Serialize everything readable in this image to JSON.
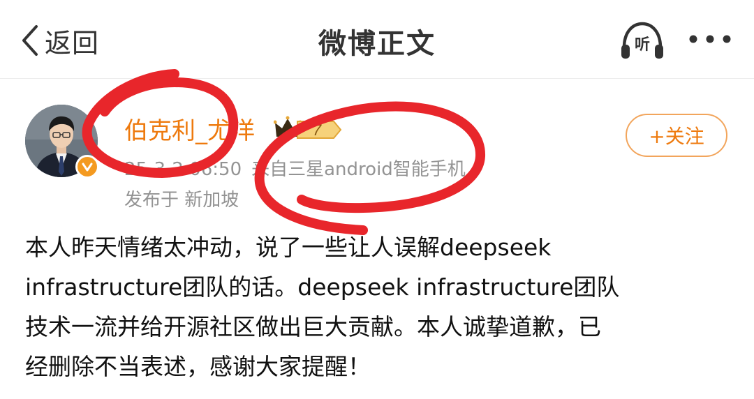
{
  "nav": {
    "back_label": "返回",
    "title": "微博正文",
    "listen_label": "听",
    "icons": {
      "back": "chevron-left-icon",
      "listen": "headphones-icon",
      "more": "more-dots-icon"
    }
  },
  "post": {
    "author": {
      "name": "伯克利_尤洋",
      "verified": true,
      "vip_level": "7"
    },
    "meta": {
      "time": "25-3-2 06:50",
      "source": "来自三星android智能手机",
      "location": "发布于 新加坡"
    },
    "follow_label": "+关注",
    "text_lines": [
      "本人昨天情绪太冲动，说了一些让人误解deepseek",
      "infrastructure团队的话。deepseek infrastructure团队",
      "技术一流并给开源社区做出巨大贡献。本人诚挚道歉，已",
      "经删除不当表述，感谢大家提醒！"
    ]
  },
  "colors": {
    "accent_orange": "#ee7a0e",
    "follow_border": "#f2a55c",
    "meta_gray": "#939393",
    "annotation_red": "#e8262b",
    "verify_badge": "#f49a20"
  }
}
